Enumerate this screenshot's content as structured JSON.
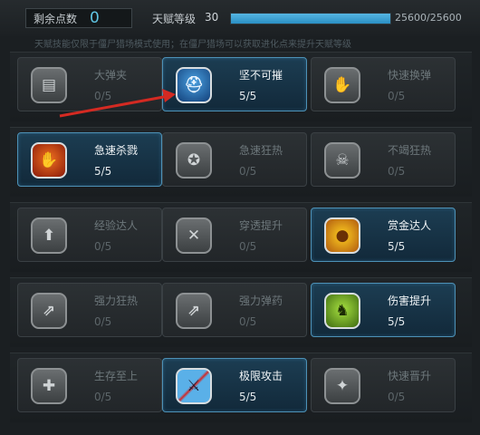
{
  "header": {
    "remaining_points_label": "剩余点数",
    "remaining_points_value": "0",
    "talent_level_label": "天赋等级",
    "talent_level_value": "30",
    "xp_text": "25600/25600",
    "xp_progress": 1.0,
    "hint": "天赋技能仅限于僵尸猎场模式使用；在僵尸猎场可以获取进化点来提升天赋等级"
  },
  "rows": [
    [
      {
        "name": "大弹夹",
        "level": "0/5",
        "active": false,
        "icon": "magazine-icon",
        "glyph": "▤"
      },
      {
        "name": "坚不可摧",
        "level": "5/5",
        "active": true,
        "icon": "helmet-icon",
        "glyph": "⛑"
      },
      {
        "name": "快速换弹",
        "level": "0/5",
        "active": false,
        "icon": "hand-reload-icon",
        "glyph": "✋"
      }
    ],
    [
      {
        "name": "急速杀戮",
        "level": "5/5",
        "active": true,
        "icon": "claw-icon",
        "glyph": "✋"
      },
      {
        "name": "急速狂热",
        "level": "0/5",
        "active": false,
        "icon": "frenzy-icon",
        "glyph": "✪"
      },
      {
        "name": "不竭狂热",
        "level": "0/5",
        "active": false,
        "icon": "skull-icon",
        "glyph": "☠"
      }
    ],
    [
      {
        "name": "经验达人",
        "level": "0/5",
        "active": false,
        "icon": "exp-up-icon",
        "glyph": "⬆"
      },
      {
        "name": "穿透提升",
        "level": "0/5",
        "active": false,
        "icon": "pierce-icon",
        "glyph": "✕"
      },
      {
        "name": "赏金达人",
        "level": "5/5",
        "active": true,
        "icon": "gold-coin-icon",
        "glyph": "●"
      }
    ],
    [
      {
        "name": "强力狂热",
        "level": "0/5",
        "active": false,
        "icon": "power-frenzy-icon",
        "glyph": "⇗"
      },
      {
        "name": "强力弹药",
        "level": "0/5",
        "active": false,
        "icon": "ammo-icon",
        "glyph": "⇗"
      },
      {
        "name": "伤害提升",
        "level": "5/5",
        "active": true,
        "icon": "zombie-dog-icon",
        "glyph": "♞"
      }
    ],
    [
      {
        "name": "生存至上",
        "level": "0/5",
        "active": false,
        "icon": "medkit-icon",
        "glyph": "✚"
      },
      {
        "name": "极限攻击",
        "level": "5/5",
        "active": true,
        "icon": "slash-attack-icon",
        "glyph": "⚔"
      },
      {
        "name": "快速晋升",
        "level": "0/5",
        "active": false,
        "icon": "promotion-icon",
        "glyph": "✦"
      }
    ]
  ],
  "annotation_arrow_color": "#d42a22"
}
